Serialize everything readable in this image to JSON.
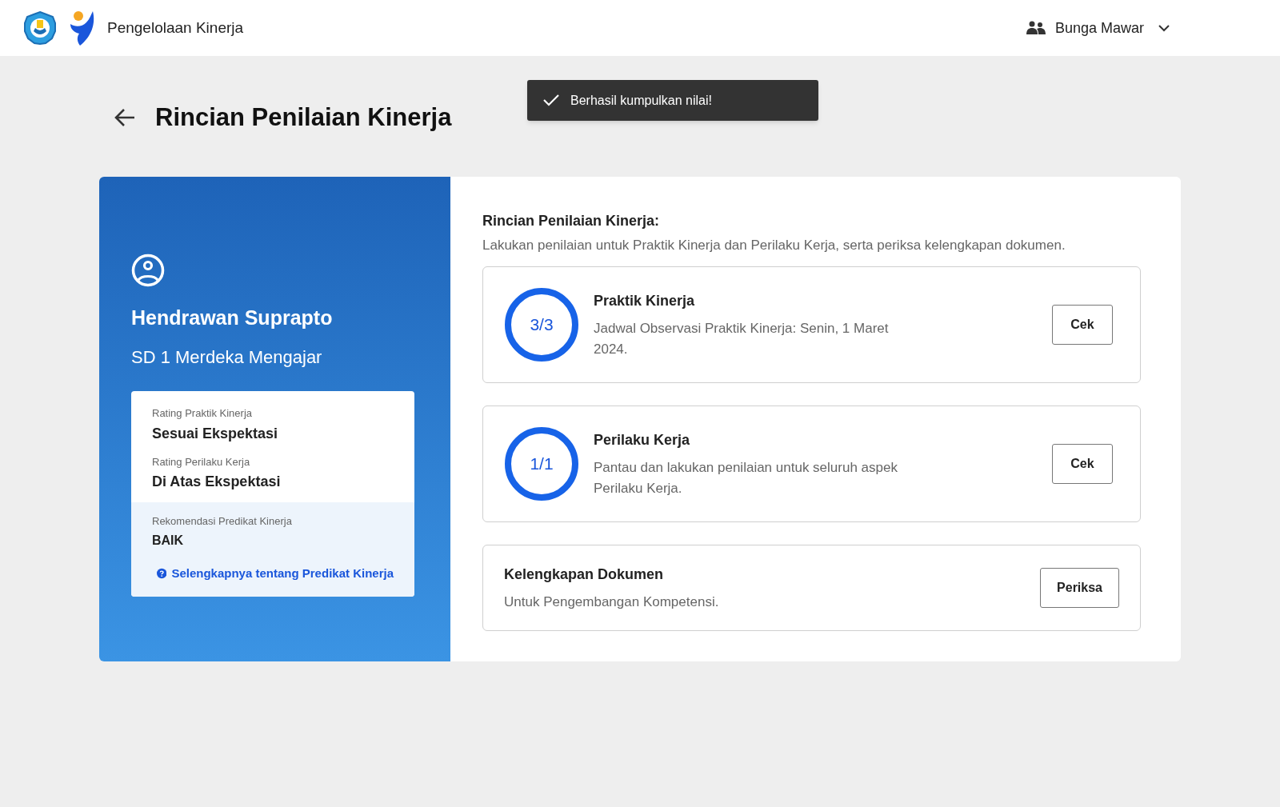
{
  "header": {
    "app_title": "Pengelolaan Kinerja",
    "user_name": "Bunga Mawar"
  },
  "toast": {
    "message": "Berhasil kumpulkan nilai!"
  },
  "page_title": "Rincian Penilaian Kinerja",
  "profile": {
    "name": "Hendrawan Suprapto",
    "school": "SD 1 Merdeka Mengajar",
    "ratings": [
      {
        "label": "Rating Praktik Kinerja",
        "value": "Sesuai Ekspektasi"
      },
      {
        "label": "Rating Perilaku Kerja",
        "value": "Di Atas Ekspektasi"
      }
    ],
    "recommendation": {
      "label": "Rekomendasi Predikat Kinerja",
      "value": "BAIK",
      "link": "Selengkapnya tentang Predikat Kinerja"
    }
  },
  "details": {
    "title": "Rincian Penilaian Kinerja:",
    "subtitle": "Lakukan penilaian untuk Praktik Kinerja dan Perilaku Kerja, serta periksa kelengkapan dokumen.",
    "items": [
      {
        "kind": "progress",
        "score": "3/3",
        "title": "Praktik Kinerja",
        "description": "Jadwal Observasi Praktik Kinerja: Senin, 1 Maret 2024.",
        "button": "Cek"
      },
      {
        "kind": "progress",
        "score": "1/1",
        "title": "Perilaku Kerja",
        "description": "Pantau dan lakukan penilaian untuk seluruh aspek Perilaku Kerja.",
        "button": "Cek"
      },
      {
        "kind": "document",
        "title": "Kelengkapan Dokumen",
        "description": "Untuk Pengembangan Kompetensi.",
        "button": "Periksa"
      }
    ]
  }
}
